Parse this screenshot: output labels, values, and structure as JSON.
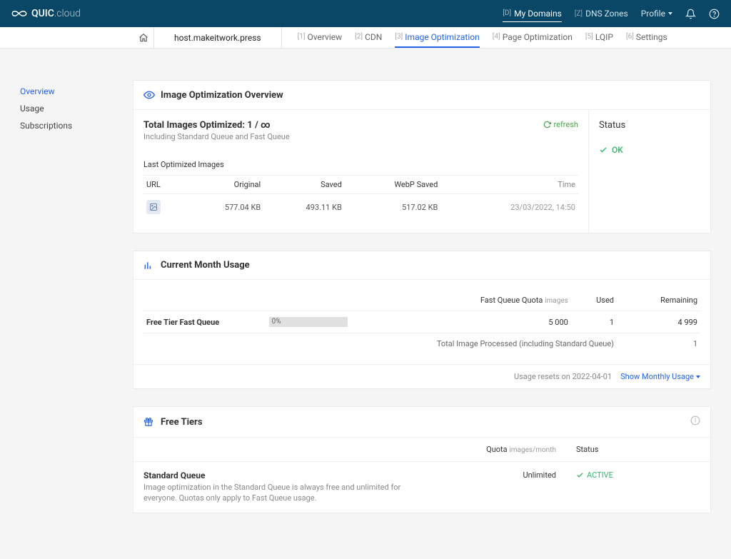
{
  "brand": {
    "name": "QUIC",
    "suffix": ".cloud"
  },
  "topnav": {
    "domains": {
      "index": "[D]",
      "label": "My Domains"
    },
    "dns": {
      "index": "[Z]",
      "label": "DNS Zones"
    },
    "profile": "Profile"
  },
  "crumb": {
    "domain": "host.makeitwork.press"
  },
  "tabs": [
    {
      "index": "[1]",
      "label": "Overview"
    },
    {
      "index": "[2]",
      "label": "CDN"
    },
    {
      "index": "[3]",
      "label": "Image Optimization",
      "active": true
    },
    {
      "index": "[4]",
      "label": "Page Optimization"
    },
    {
      "index": "[5]",
      "label": "LQIP"
    },
    {
      "index": "[6]",
      "label": "Settings"
    }
  ],
  "sidebar": {
    "overview": "Overview",
    "usage": "Usage",
    "subscriptions": "Subscriptions"
  },
  "overviewCard": {
    "header": "Image Optimization Overview",
    "title": "Total Images Optimized: 1 / ∞",
    "subtitle": "Including Standard Queue and Fast Queue",
    "refresh": "refresh",
    "lastOptLabel": "Last Optimized Images",
    "cols": {
      "url": "URL",
      "original": "Original",
      "saved": "Saved",
      "webp": "WebP Saved",
      "time": "Time"
    },
    "row": {
      "original": "577.04 KB",
      "saved": "493.11 KB",
      "webp": "517.02 KB",
      "time": "23/03/2022, 14:50"
    },
    "statusLabel": "Status",
    "statusValue": "OK"
  },
  "usageCard": {
    "header": "Current Month Usage",
    "cols": {
      "quota": "Fast Queue Quota",
      "quotaUnit": "images",
      "used": "Used",
      "remaining": "Remaining"
    },
    "row": {
      "name": "Free Tier Fast Queue",
      "progress": "0%",
      "quota": "5 000",
      "used": "1",
      "remaining": "4 999"
    },
    "totalLabel": "Total Image Processed (including Standard Queue)",
    "totalValue": "1",
    "resetInfo": "Usage resets on 2022-04-01",
    "showLink": "Show Monthly Usage"
  },
  "tiersCard": {
    "header": "Free Tiers",
    "cols": {
      "quota": "Quota",
      "quotaUnit": "images/month",
      "status": "Status"
    },
    "row": {
      "name": "Standard Queue",
      "desc": "Image optimization in the Standard Queue is always free and unlimited for everyone. Quotas only apply to Fast Queue usage.",
      "quota": "Unlimited",
      "status": "ACTIVE"
    }
  }
}
